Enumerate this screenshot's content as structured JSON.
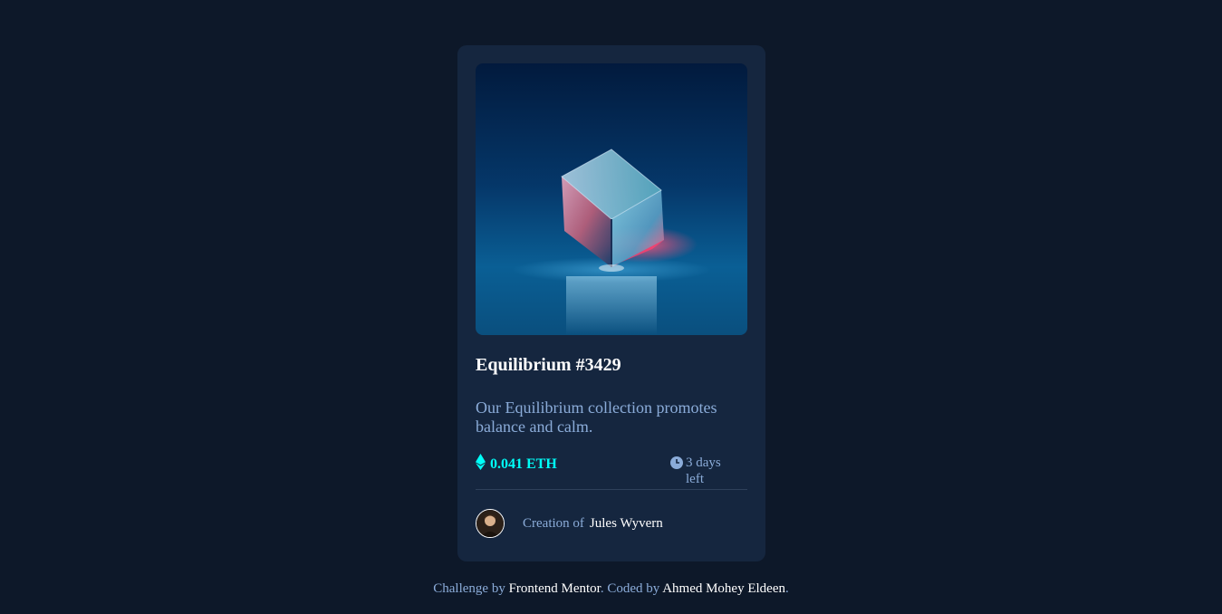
{
  "card": {
    "image_alt": "Equilibrium crystal cube",
    "title": "Equilibrium #3429",
    "description": "Our Equilibrium collection promotes balance and calm.",
    "price": "0.041 ETH",
    "price_icon": "ethereum-icon",
    "time_left": "3 days left",
    "time_icon": "clock-icon",
    "creator_prefix": "Creation of",
    "creator_name": "Jules Wyvern"
  },
  "footer": {
    "prefix": "Challenge by",
    "challenge_link": "Frontend Mentor",
    "middle": ". Coded by",
    "author_link": "Ahmed Mohey Eldeen",
    "suffix": "."
  },
  "colors": {
    "page_background": "#0d1829",
    "card_background": "#15263f",
    "accent_cyan": "#00fff8",
    "soft_blue_text": "#8bacd9",
    "white": "#ffffff"
  }
}
